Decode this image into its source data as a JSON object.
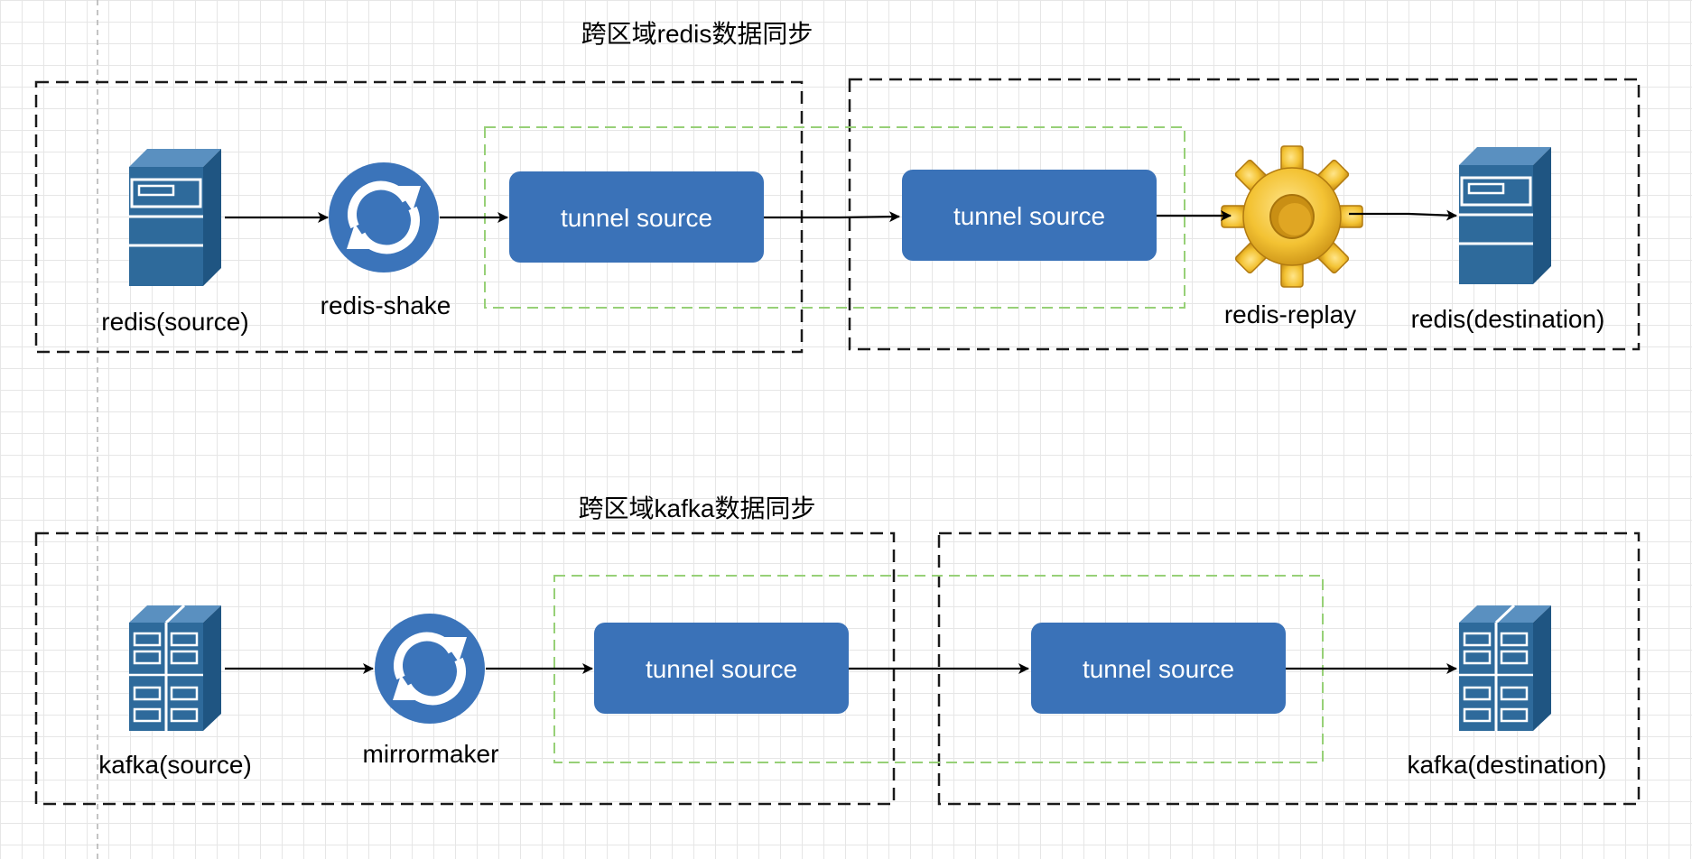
{
  "colors": {
    "tunnel_fill": "#3a72b8",
    "server_blue": "#2e6a9b",
    "sync_circle": "#3b74ba",
    "zone_border": "#1a1a1a",
    "tunnel_zone_border": "#97d077",
    "gear_gold": "#f3c233",
    "arrow": "#000000"
  },
  "redis_sync": {
    "title": "跨区域redis数据同步",
    "source_icon": "server-icon",
    "source_label": "redis(source)",
    "tool_icon": "sync-icon",
    "tool_label": "redis-shake",
    "tunnel_left": "tunnel source",
    "tunnel_right": "tunnel source",
    "replay_icon": "gear-icon",
    "replay_label": "redis-replay",
    "dest_icon": "server-icon",
    "dest_label": "redis(destination)"
  },
  "kafka_sync": {
    "title": "跨区域kafka数据同步",
    "source_icon": "server-rack-icon",
    "source_label": "kafka(source)",
    "tool_icon": "sync-icon",
    "tool_label": "mirrormaker",
    "tunnel_left": "tunnel source",
    "tunnel_right": "tunnel source",
    "dest_icon": "server-rack-icon",
    "dest_label": "kafka(destination)"
  }
}
